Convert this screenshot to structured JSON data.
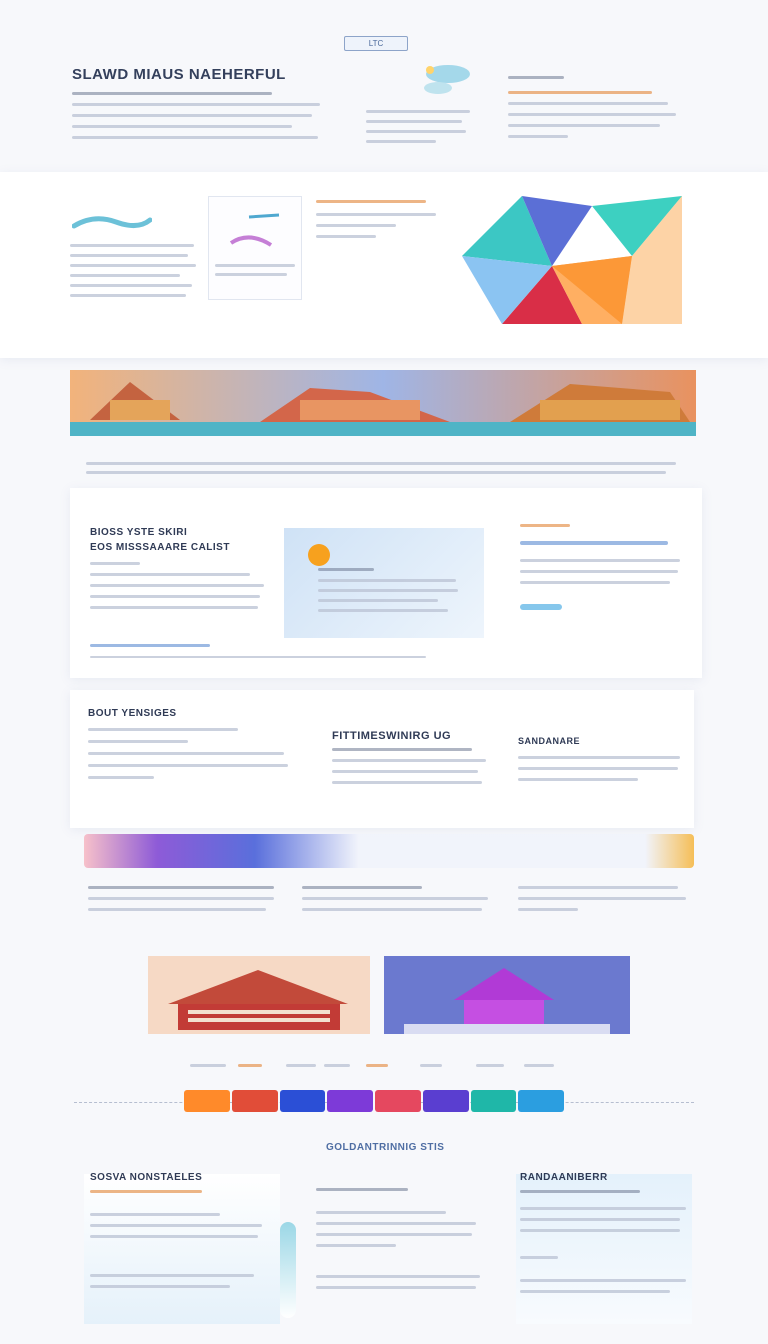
{
  "header": {
    "logo_text": "LTC",
    "title": "SLAWD MIAUS NAEHERFUL"
  },
  "section_titles": {
    "info_block_1": "BIOSS YSTE SKIRI",
    "info_block_1_sub": "EOS MISSSAAARE CALIST",
    "feature_head": "BOUT YENSIGES",
    "center_head": "FITTIMESWINIRG UG",
    "mid_right_head": "SANDANARE",
    "footer_center": "GOLDANTRINNIG STIS",
    "footer_left_head": "SOSVA NONSTAELES",
    "footer_right_head": "RANDAANIBERR"
  },
  "colors": {
    "accent_blue": "#3f6fc0",
    "accent_orange": "#f1a23a",
    "accent_purple": "#7b3fd1",
    "accent_teal": "#1fb7a8"
  },
  "timeline": {
    "segments": [
      "#ff8a2a",
      "#e14d38",
      "#2b4fd6",
      "#7d3ad8",
      "#e5485f",
      "#5a3ed0",
      "#1fb7a8",
      "#2b9ee0"
    ]
  }
}
